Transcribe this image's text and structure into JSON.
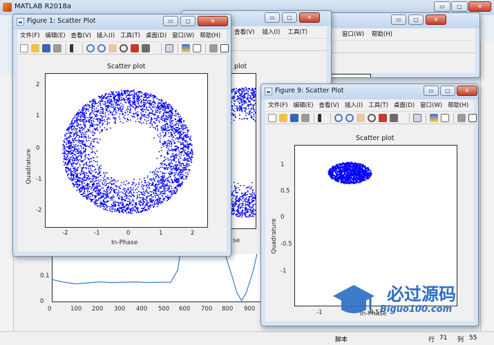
{
  "matlab": {
    "title": "MATLAB R2018a",
    "status_bar": {
      "script_label": "脚本",
      "row_label": "行",
      "row": "71",
      "col_label": "列",
      "col": "55"
    }
  },
  "menu_items": [
    "文件(F)",
    "编辑(E)",
    "查看(V)",
    "插入(I)",
    "工具(T)",
    "桌面(D)",
    "窗口(W)",
    "帮助(H)"
  ],
  "window_buttons": {
    "minimize": "▭",
    "maximize": "▢",
    "close": "✕"
  },
  "figure1": {
    "title": "Figure 1: Scatter Plot",
    "plot_title": "Scatter plot",
    "xlabel": "In-Phase",
    "ylabel": "Quadrature",
    "xticks": [
      "-2",
      "-1",
      "0",
      "1",
      "2"
    ],
    "yticks": [
      "2",
      "1",
      "0",
      "-1",
      "-2"
    ]
  },
  "figure9": {
    "title": "Figure 9: Scatter Plot",
    "plot_title": "Scatter plot",
    "xlabel": "In-Phase",
    "ylabel": "Quadrature",
    "xticks": [
      "-1",
      "-0.5"
    ],
    "yticks": [
      "1",
      "0.5",
      "0",
      "-0.5",
      "-1"
    ]
  },
  "back_figure": {
    "plot_title_fragment": "plot",
    "xlabel_fragment": "se"
  },
  "line_plot": {
    "xticks": [
      "0",
      "100",
      "200",
      "300",
      "400",
      "500",
      "600",
      "700",
      "800",
      "900"
    ],
    "yticks": [
      "0.1",
      "0"
    ]
  },
  "watermark": {
    "text": "必过源码",
    "url": "Biguo100.com"
  },
  "chart_data": [
    {
      "type": "scatter",
      "title": "Scatter plot",
      "xlabel": "In-Phase",
      "ylabel": "Quadrature",
      "xlim": [
        -2.5,
        2.5
      ],
      "ylim": [
        -2.5,
        2.5
      ],
      "ring": {
        "center": [
          0,
          0
        ],
        "inner_radius": 0.9,
        "outer_radius": 2.0,
        "points": 3500,
        "color": "#0000ff"
      }
    },
    {
      "type": "scatter",
      "title": "Scatter plot",
      "xlabel": "In-Phase",
      "ylabel": "Quadrature",
      "xlim": [
        -1.5,
        0.0
      ],
      "ylim": [
        -1.5,
        1.5
      ],
      "cluster": {
        "center": [
          -1.0,
          1.0
        ],
        "radius": 0.2,
        "points": 1400,
        "color": "#0000ff"
      }
    },
    {
      "type": "line",
      "xlim": [
        0,
        950
      ],
      "ylim": [
        0,
        0.15
      ],
      "x": [
        0,
        50,
        100,
        150,
        200,
        250,
        300,
        350,
        400,
        450,
        500,
        530,
        550,
        600,
        650,
        700,
        730,
        760,
        780,
        800,
        820,
        850,
        880,
        900,
        950
      ],
      "y": [
        0.07,
        0.062,
        0.057,
        0.06,
        0.063,
        0.061,
        0.062,
        0.063,
        0.061,
        0.062,
        0.062,
        0.1,
        0.2,
        0.2,
        0.2,
        0.2,
        0.15,
        0.08,
        0.03,
        0.005,
        0.03,
        0.1,
        0.2,
        0.2,
        0.2
      ],
      "color": "#3a7ac2"
    }
  ]
}
